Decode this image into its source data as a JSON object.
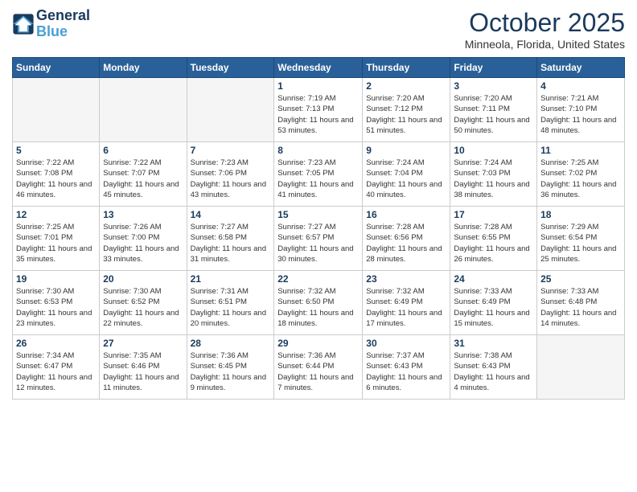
{
  "logo": {
    "line1": "General",
    "line2": "Blue"
  },
  "header": {
    "month": "October 2025",
    "location": "Minneola, Florida, United States"
  },
  "days_of_week": [
    "Sunday",
    "Monday",
    "Tuesday",
    "Wednesday",
    "Thursday",
    "Friday",
    "Saturday"
  ],
  "weeks": [
    [
      {
        "day": "",
        "info": ""
      },
      {
        "day": "",
        "info": ""
      },
      {
        "day": "",
        "info": ""
      },
      {
        "day": "1",
        "info": "Sunrise: 7:19 AM\nSunset: 7:13 PM\nDaylight: 11 hours\nand 53 minutes."
      },
      {
        "day": "2",
        "info": "Sunrise: 7:20 AM\nSunset: 7:12 PM\nDaylight: 11 hours\nand 51 minutes."
      },
      {
        "day": "3",
        "info": "Sunrise: 7:20 AM\nSunset: 7:11 PM\nDaylight: 11 hours\nand 50 minutes."
      },
      {
        "day": "4",
        "info": "Sunrise: 7:21 AM\nSunset: 7:10 PM\nDaylight: 11 hours\nand 48 minutes."
      }
    ],
    [
      {
        "day": "5",
        "info": "Sunrise: 7:22 AM\nSunset: 7:08 PM\nDaylight: 11 hours\nand 46 minutes."
      },
      {
        "day": "6",
        "info": "Sunrise: 7:22 AM\nSunset: 7:07 PM\nDaylight: 11 hours\nand 45 minutes."
      },
      {
        "day": "7",
        "info": "Sunrise: 7:23 AM\nSunset: 7:06 PM\nDaylight: 11 hours\nand 43 minutes."
      },
      {
        "day": "8",
        "info": "Sunrise: 7:23 AM\nSunset: 7:05 PM\nDaylight: 11 hours\nand 41 minutes."
      },
      {
        "day": "9",
        "info": "Sunrise: 7:24 AM\nSunset: 7:04 PM\nDaylight: 11 hours\nand 40 minutes."
      },
      {
        "day": "10",
        "info": "Sunrise: 7:24 AM\nSunset: 7:03 PM\nDaylight: 11 hours\nand 38 minutes."
      },
      {
        "day": "11",
        "info": "Sunrise: 7:25 AM\nSunset: 7:02 PM\nDaylight: 11 hours\nand 36 minutes."
      }
    ],
    [
      {
        "day": "12",
        "info": "Sunrise: 7:25 AM\nSunset: 7:01 PM\nDaylight: 11 hours\nand 35 minutes."
      },
      {
        "day": "13",
        "info": "Sunrise: 7:26 AM\nSunset: 7:00 PM\nDaylight: 11 hours\nand 33 minutes."
      },
      {
        "day": "14",
        "info": "Sunrise: 7:27 AM\nSunset: 6:58 PM\nDaylight: 11 hours\nand 31 minutes."
      },
      {
        "day": "15",
        "info": "Sunrise: 7:27 AM\nSunset: 6:57 PM\nDaylight: 11 hours\nand 30 minutes."
      },
      {
        "day": "16",
        "info": "Sunrise: 7:28 AM\nSunset: 6:56 PM\nDaylight: 11 hours\nand 28 minutes."
      },
      {
        "day": "17",
        "info": "Sunrise: 7:28 AM\nSunset: 6:55 PM\nDaylight: 11 hours\nand 26 minutes."
      },
      {
        "day": "18",
        "info": "Sunrise: 7:29 AM\nSunset: 6:54 PM\nDaylight: 11 hours\nand 25 minutes."
      }
    ],
    [
      {
        "day": "19",
        "info": "Sunrise: 7:30 AM\nSunset: 6:53 PM\nDaylight: 11 hours\nand 23 minutes."
      },
      {
        "day": "20",
        "info": "Sunrise: 7:30 AM\nSunset: 6:52 PM\nDaylight: 11 hours\nand 22 minutes."
      },
      {
        "day": "21",
        "info": "Sunrise: 7:31 AM\nSunset: 6:51 PM\nDaylight: 11 hours\nand 20 minutes."
      },
      {
        "day": "22",
        "info": "Sunrise: 7:32 AM\nSunset: 6:50 PM\nDaylight: 11 hours\nand 18 minutes."
      },
      {
        "day": "23",
        "info": "Sunrise: 7:32 AM\nSunset: 6:49 PM\nDaylight: 11 hours\nand 17 minutes."
      },
      {
        "day": "24",
        "info": "Sunrise: 7:33 AM\nSunset: 6:49 PM\nDaylight: 11 hours\nand 15 minutes."
      },
      {
        "day": "25",
        "info": "Sunrise: 7:33 AM\nSunset: 6:48 PM\nDaylight: 11 hours\nand 14 minutes."
      }
    ],
    [
      {
        "day": "26",
        "info": "Sunrise: 7:34 AM\nSunset: 6:47 PM\nDaylight: 11 hours\nand 12 minutes."
      },
      {
        "day": "27",
        "info": "Sunrise: 7:35 AM\nSunset: 6:46 PM\nDaylight: 11 hours\nand 11 minutes."
      },
      {
        "day": "28",
        "info": "Sunrise: 7:36 AM\nSunset: 6:45 PM\nDaylight: 11 hours\nand 9 minutes."
      },
      {
        "day": "29",
        "info": "Sunrise: 7:36 AM\nSunset: 6:44 PM\nDaylight: 11 hours\nand 7 minutes."
      },
      {
        "day": "30",
        "info": "Sunrise: 7:37 AM\nSunset: 6:43 PM\nDaylight: 11 hours\nand 6 minutes."
      },
      {
        "day": "31",
        "info": "Sunrise: 7:38 AM\nSunset: 6:43 PM\nDaylight: 11 hours\nand 4 minutes."
      },
      {
        "day": "",
        "info": ""
      }
    ]
  ]
}
